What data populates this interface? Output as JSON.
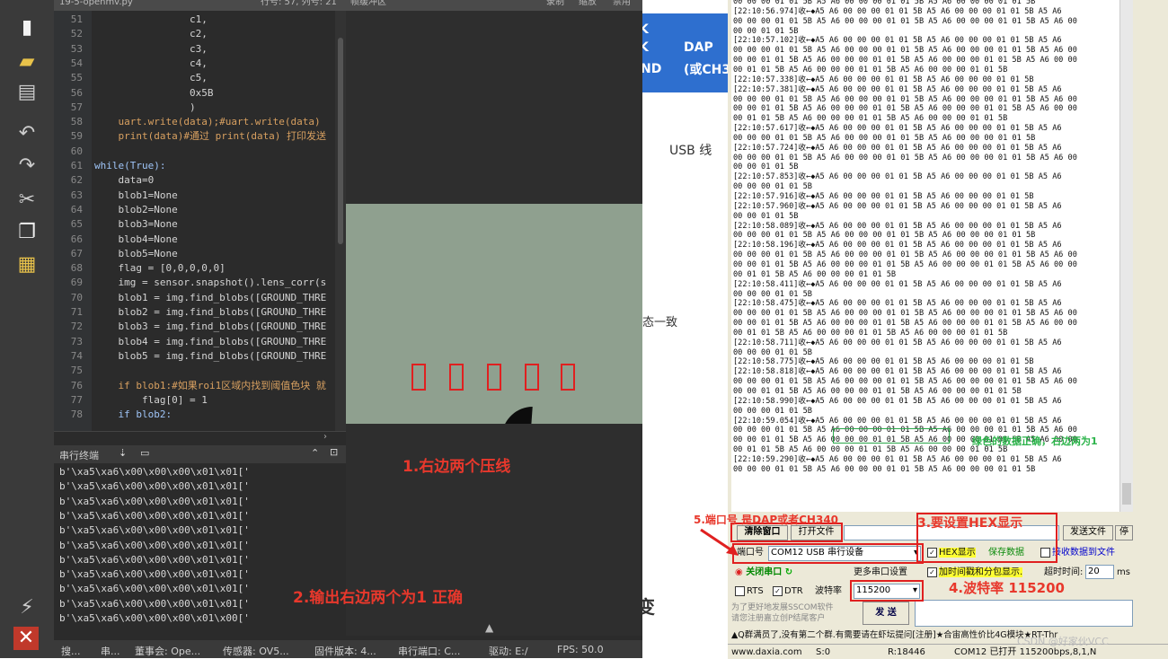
{
  "ide": {
    "title": "19-5-openmv.py",
    "position": "行号: 57, 列号: 21",
    "mode": "帧缓冲区",
    "tabs": [
      "录制",
      "缩放",
      "禁用"
    ],
    "code_lines": [
      {
        "n": "51",
        "t": "                c1,"
      },
      {
        "n": "52",
        "t": "                c2,"
      },
      {
        "n": "53",
        "t": "                c3,"
      },
      {
        "n": "54",
        "t": "                c4,"
      },
      {
        "n": "55",
        "t": "                c5,"
      },
      {
        "n": "56",
        "t": "                0x5B"
      },
      {
        "n": "57",
        "t": "                )"
      },
      {
        "n": "58",
        "t": "    uart.write(data);#uart.write(data)"
      },
      {
        "n": "59",
        "t": "    print(data)#通过 print(data) 打印发送"
      },
      {
        "n": "60",
        "t": ""
      },
      {
        "n": "61",
        "t": "while(True):"
      },
      {
        "n": "62",
        "t": "    data=0"
      },
      {
        "n": "63",
        "t": "    blob1=None"
      },
      {
        "n": "64",
        "t": "    blob2=None"
      },
      {
        "n": "65",
        "t": "    blob3=None"
      },
      {
        "n": "66",
        "t": "    blob4=None"
      },
      {
        "n": "67",
        "t": "    blob5=None"
      },
      {
        "n": "68",
        "t": "    flag = [0,0,0,0,0]"
      },
      {
        "n": "69",
        "t": "    img = sensor.snapshot().lens_corr(s"
      },
      {
        "n": "70",
        "t": "    blob1 = img.find_blobs([GROUND_THRE"
      },
      {
        "n": "71",
        "t": "    blob2 = img.find_blobs([GROUND_THRE"
      },
      {
        "n": "72",
        "t": "    blob3 = img.find_blobs([GROUND_THRE"
      },
      {
        "n": "73",
        "t": "    blob4 = img.find_blobs([GROUND_THRE"
      },
      {
        "n": "74",
        "t": "    blob5 = img.find_blobs([GROUND_THRE"
      },
      {
        "n": "75",
        "t": ""
      },
      {
        "n": "76",
        "t": "    if blob1:#如果roi1区域内找到阈值色块 就"
      },
      {
        "n": "77",
        "t": "        flag[0] = 1"
      },
      {
        "n": "78",
        "t": "    if blob2:"
      }
    ],
    "terminal_title": "串行终端",
    "terminal_lines": [
      "b'\\xa5\\xa6\\x00\\x00\\x00\\x01\\x01['",
      "b'\\xa5\\xa6\\x00\\x00\\x00\\x01\\x01['",
      "b'\\xa5\\xa6\\x00\\x00\\x00\\x01\\x01['",
      "b'\\xa5\\xa6\\x00\\x00\\x00\\x01\\x01['",
      "b'\\xa5\\xa6\\x00\\x00\\x00\\x01\\x01['",
      "b'\\xa5\\xa6\\x00\\x00\\x00\\x01\\x01['",
      "b'\\xa5\\xa6\\x00\\x00\\x00\\x01\\x01['",
      "b'\\xa5\\xa6\\x00\\x00\\x00\\x01\\x01['",
      "b'\\xa5\\xa6\\x00\\x00\\x00\\x01\\x01['",
      "b'\\xa5\\xa6\\x00\\x00\\x00\\x01\\x01['",
      "b'\\xa5\\xa6\\x00\\x00\\x00\\x01\\x00['"
    ],
    "statusbar": [
      "搜...",
      "串...",
      "董事会: Ope...",
      "传感器: OV5...",
      "固件版本: 4...",
      "串行端口: C...",
      "驱动: E:/",
      "FPS:  50.0"
    ]
  },
  "annotations": {
    "a1": "1.右边两个压线",
    "a2": "2.输出右边两个为1 正确",
    "a3": "3.要设置HEX显示",
    "a4": "4.波特率 115200",
    "a5": "5.端口号 是DAP或者CH340",
    "green_note": "绿色的数据正确，右边两为1"
  },
  "slide": {
    "t1": "K",
    "t2": "K",
    "t3": "ND",
    "dap": "DAP",
    "dap2": "(或CH3",
    "usb": "USB 线",
    "state": "态一致",
    "bottom": "变"
  },
  "sscom": {
    "log_lines": [
      "00 00 00 01 01 5B A5 A6 00 00 00 01 01 5B A5 A6 00 00 00 01 01 5B",
      "[22:10:56.974]收←◆A5 A6 00 00 00 01 01 5B A5 A6 00 00 00 01 01 5B A5 A6",
      "00 00 00 01 01 5B A5 A6 00 00 00 01 01 5B A5 A6 00 00 00 01 01 5B A5 A6 00",
      "00 00 01 01 5B",
      "[22:10:57.102]收←◆A5 A6 00 00 00 01 01 5B A5 A6 00 00 00 01 01 5B A5 A6",
      "00 00 00 01 01 5B A5 A6 00 00 00 01 01 5B A5 A6 00 00 00 01 01 5B A5 A6 00",
      "00 00 01 01 5B A5 A6 00 00 00 01 01 5B A5 A6 00 00 00 01 01 5B A5 A6 00 00",
      "00 01 01 5B A5 A6 00 00 00 01 01 5B A5 A6 00 00 00 01 01 5B",
      "[22:10:57.338]收←◆A5 A6 00 00 00 01 01 5B A5 A6 00 00 00 01 01 5B",
      "[22:10:57.381]收←◆A5 A6 00 00 00 01 01 5B A5 A6 00 00 00 01 01 5B A5 A6",
      "00 00 00 01 01 5B A5 A6 00 00 00 01 01 5B A5 A6 00 00 00 01 01 5B A5 A6 00",
      "00 00 01 01 5B A5 A6 00 00 00 01 01 5B A5 A6 00 00 00 01 01 5B A5 A6 00 00",
      "00 01 01 5B A5 A6 00 00 00 01 01 5B A5 A6 00 00 00 01 01 5B",
      "[22:10:57.617]收←◆A5 A6 00 00 00 01 01 5B A5 A6 00 00 00 01 01 5B A5 A6",
      "00 00 00 01 01 5B A5 A6 00 00 00 01 01 5B A5 A6 00 00 00 01 01 5B",
      "[22:10:57.724]收←◆A5 A6 00 00 00 01 01 5B A5 A6 00 00 00 01 01 5B A5 A6",
      "00 00 00 01 01 5B A5 A6 00 00 00 01 01 5B A5 A6 00 00 00 01 01 5B A5 A6 00",
      "00 00 01 01 5B",
      "[22:10:57.853]收←◆A5 A6 00 00 00 01 01 5B A5 A6 00 00 00 01 01 5B A5 A6",
      "00 00 00 01 01 5B",
      "[22:10:57.916]收←◆A5 A6 00 00 00 01 01 5B A5 A6 00 00 00 01 01 5B",
      "[22:10:57.960]收←◆A5 A6 00 00 00 01 01 5B A5 A6 00 00 00 01 01 5B A5 A6",
      "00 00 01 01 5B",
      "[22:10:58.089]收←◆A5 A6 00 00 00 01 01 5B A5 A6 00 00 00 01 01 5B A5 A6",
      "00 00 00 01 01 5B A5 A6 00 00 00 01 01 5B A5 A6 00 00 00 01 01 5B",
      "[22:10:58.196]收←◆A5 A6 00 00 00 01 01 5B A5 A6 00 00 00 01 01 5B A5 A6",
      "00 00 00 01 01 5B A5 A6 00 00 00 01 01 5B A5 A6 00 00 00 01 01 5B A5 A6 00",
      "00 00 01 01 5B A5 A6 00 00 00 01 01 5B A5 A6 00 00 00 01 01 5B A5 A6 00 00",
      "00 01 01 5B A5 A6 00 00 00 01 01 5B",
      "[22:10:58.411]收←◆A5 A6 00 00 00 01 01 5B A5 A6 00 00 00 01 01 5B A5 A6",
      "00 00 00 01 01 5B",
      "[22:10:58.475]收←◆A5 A6 00 00 00 01 01 5B A5 A6 00 00 00 01 01 5B A5 A6",
      "00 00 00 01 01 5B A5 A6 00 00 00 01 01 5B A5 A6 00 00 00 01 01 5B A5 A6 00",
      "00 00 01 01 5B A5 A6 00 00 00 01 01 5B A5 A6 00 00 00 01 01 5B A5 A6 00 00",
      "00 01 01 5B A5 A6 00 00 00 01 01 5B A5 A6 00 00 00 01 01 5B",
      "[22:10:58.711]收←◆A5 A6 00 00 00 01 01 5B A5 A6 00 00 00 01 01 5B A5 A6",
      "00 00 00 01 01 5B",
      "[22:10:58.775]收←◆A5 A6 00 00 00 01 01 5B A5 A6 00 00 00 01 01 5B",
      "[22:10:58.818]收←◆A5 A6 00 00 00 01 01 5B A5 A6 00 00 00 01 01 5B A5 A6",
      "00 00 00 01 01 5B A5 A6 00 00 00 01 01 5B A5 A6 00 00 00 01 01 5B A5 A6 00",
      "00 00 01 01 5B A5 A6 00 00 00 01 01 5B A5 A6 00 00 00 01 01 5B",
      "[22:10:58.990]收←◆A5 A6 00 00 00 01 01 5B A5 A6 00 00 00 01 01 5B A5 A6",
      "00 00 00 01 01 5B",
      "[22:10:59.054]收←◆A5 A6 00 00 00 01 01 5B A5 A6 00 00 00 01 01 5B A5 A6",
      "00 00 00 01 01 5B A5 A6 00 00 00 01 01 5B A5 A6 00 00 00 01 01 5B A5 A6 00",
      "00 00 01 01 5B A5 A6 00 00 00 01 01 5B A5 A6 00 00 00 01 01 5B A5 A6 00 00",
      "00 01 01 5B A5 A6 00 00 00 01 01 5B A5 A6 00 00 00 01 01 5B",
      "[22:10:59.290]收←◆A5 A6 00 00 00 01 01 5B A5 A6 00 00 00 01 01 5B A5 A6",
      "00 00 00 01 01 5B A5 A6 00 00 00 01 01 5B A5 A6 00 00 00 01 01 5B"
    ],
    "clear_btn": "清除窗口",
    "open_file_btn": "打开文件",
    "send_file_btn": "发送文件",
    "stop_btn": "停",
    "port_label": "端口号",
    "port_value": "COM12 USB 串行设备",
    "hex_label": "HEX显示",
    "save_data": "保存数据",
    "recv_to_file": "接收数据到文件",
    "close_port": "关闭串口",
    "more_settings": "更多串口设置",
    "timestamp_label": "加时间戳和分包显示.",
    "timeout_label": "超时时间:",
    "timeout_value": "20",
    "timeout_unit": "ms",
    "rts": "RTS",
    "dtr": "DTR",
    "baud_label": "波特率",
    "baud_value": "115200",
    "send_btn": "发 送",
    "promo1": "为了更好地发展SSCOM软件",
    "promo2": "请您注册嘉立创P结尾客户",
    "ticker": "▲Q群满员了,没有第二个群.有需要请在虾坛提问[注册]★合宙高性价比4G模块★RT-Thr",
    "status": [
      "www.daxia.com",
      "S:0",
      "R:18446",
      "COM12 已打开  115200bps,8,1,N"
    ],
    "watermark": "CSDN @好家伙VCC"
  }
}
